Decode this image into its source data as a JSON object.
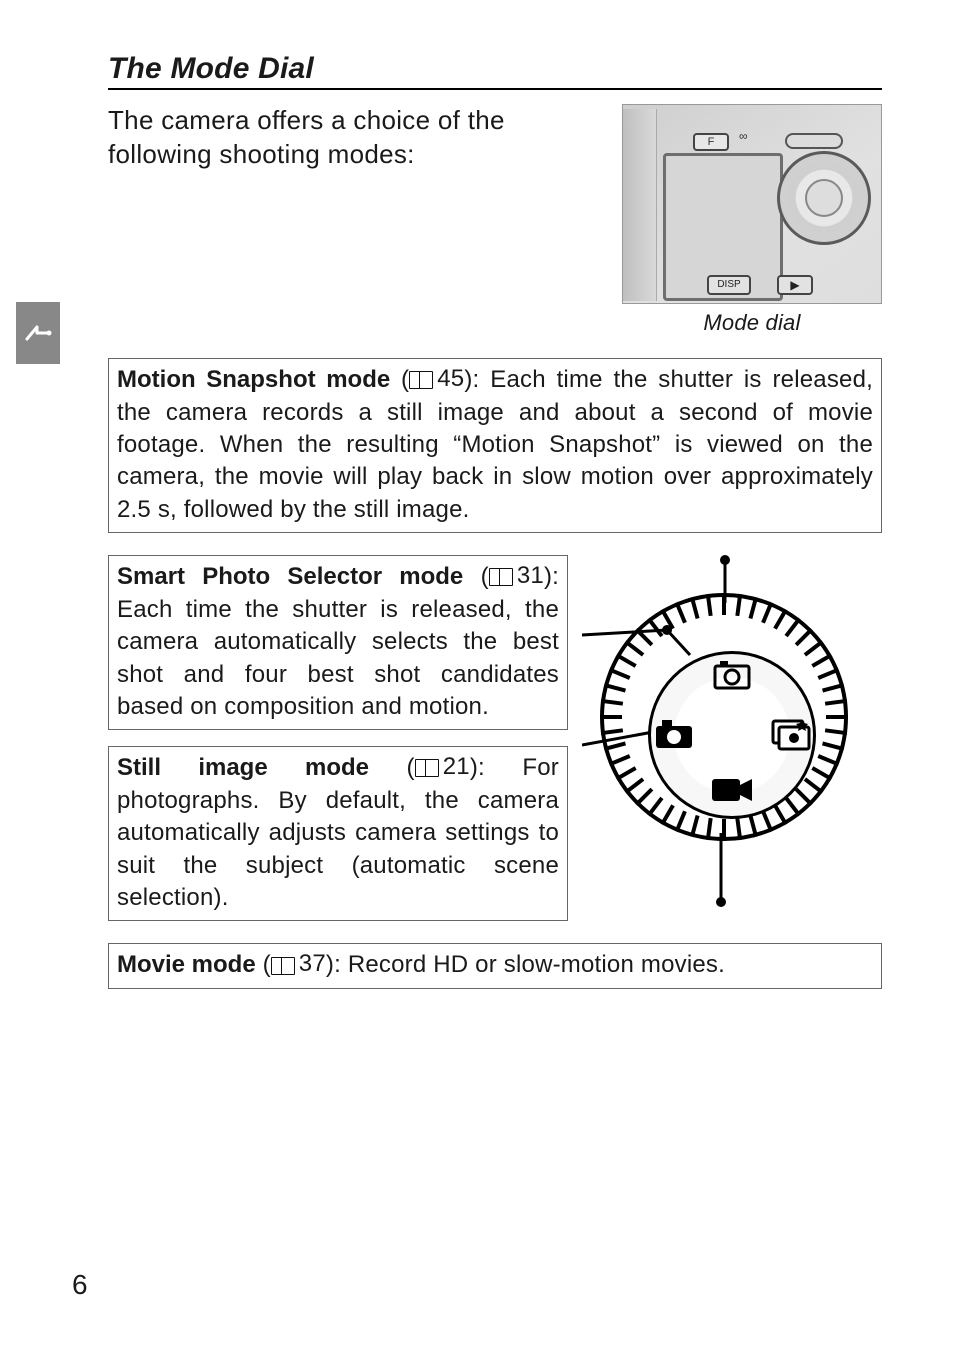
{
  "section_title": "The Mode Dial",
  "intro": "The camera offers a choice of the following shooting modes:",
  "thumb": {
    "caption": "Mode dial",
    "btn_f": "F",
    "btn_disp": "DISP",
    "btn_play": "▶"
  },
  "box_motion": {
    "head": "Motion Snapshot mode",
    "pg": "45",
    "body": "): Each time the shutter is released, the camera records a still image and about a second of movie footage. When the resulting “Motion Snapshot” is viewed on the camera, the movie will play back in slow motion over approximately 2.5 s, followed by the still image."
  },
  "box_smart": {
    "head": "Smart Photo Selector mode",
    "pg": "31",
    "body": "): Each time the shutter is released, the camera automatically selects the best shot and four best shot candidates based on composition and motion."
  },
  "box_still": {
    "head": "Still image mode",
    "pg": "21",
    "body": "): For photographs. By default, the camera automatically adjusts camera settings to suit the subject (automatic scene selection)."
  },
  "box_movie": {
    "head": "Movie mode",
    "pg": "37",
    "body": "): Record HD or slow-motion movies."
  },
  "page_number": "6"
}
